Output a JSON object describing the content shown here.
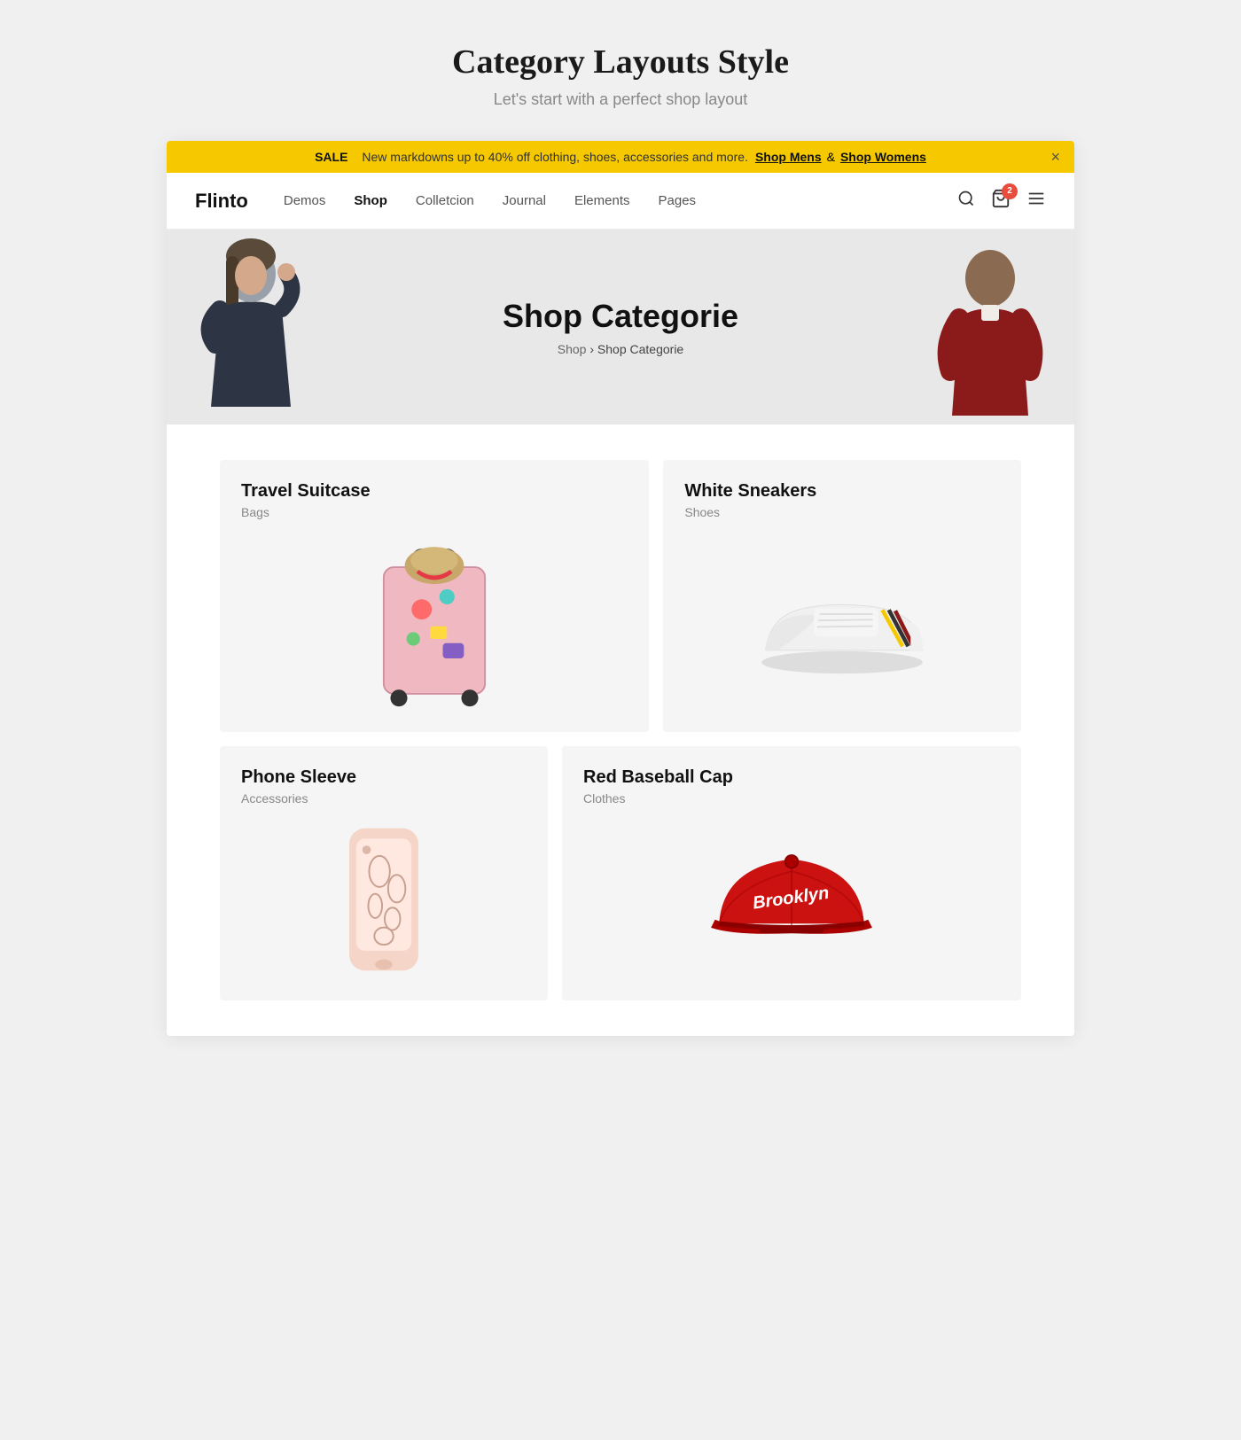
{
  "page": {
    "title": "Category Layouts Style",
    "subtitle": "Let's start with a perfect shop layout"
  },
  "announcement": {
    "sale_label": "SALE",
    "message": "New markdowns up to 40% off clothing, shoes, accessories and more.",
    "link1_text": "Shop Mens",
    "link2_text": "Shop Womens",
    "close_label": "×"
  },
  "navbar": {
    "logo": "Flinto",
    "links": [
      {
        "label": "Demos",
        "active": false
      },
      {
        "label": "Shop",
        "active": true
      },
      {
        "label": "Colletcion",
        "active": false
      },
      {
        "label": "Journal",
        "active": false
      },
      {
        "label": "Elements",
        "active": false
      },
      {
        "label": "Pages",
        "active": false
      }
    ],
    "cart_count": "2"
  },
  "hero": {
    "title": "Shop Categorie",
    "breadcrumb_home": "Shop",
    "breadcrumb_current": "Shop Categorie"
  },
  "categories": [
    {
      "title": "Travel Suitcase",
      "subtitle": "Bags",
      "size": "large"
    },
    {
      "title": "White Sneakers",
      "subtitle": "Shoes",
      "size": "normal"
    },
    {
      "title": "Phone Sleeve",
      "subtitle": "Accessories",
      "size": "normal"
    },
    {
      "title": "Red Baseball Cap",
      "subtitle": "Clothes",
      "size": "normal"
    }
  ]
}
